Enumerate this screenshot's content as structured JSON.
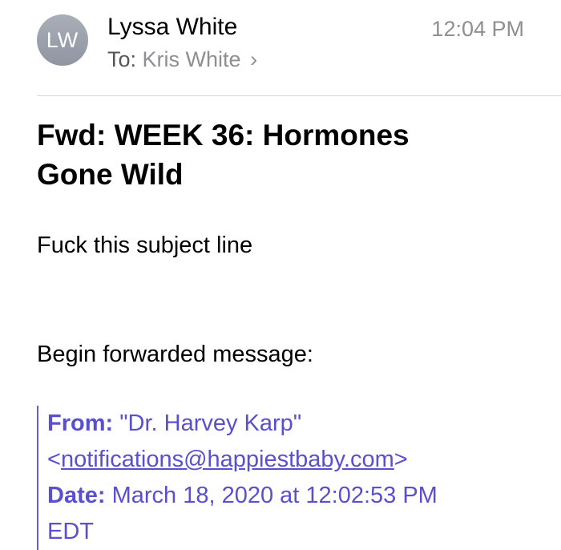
{
  "header": {
    "avatar_initials": "LW",
    "sender_name": "Lyssa White",
    "time": "12:04 PM",
    "to_label": "To:",
    "to_name": "Kris White",
    "to_chevron": "›"
  },
  "email": {
    "subject_line1": "Fwd:  WEEK 36: Hormones",
    "subject_line2": "Gone Wild",
    "body_text": "Fuck this subject line",
    "forward_intro": "Begin forwarded message:"
  },
  "forwarded": {
    "from_label": "From:",
    "from_name": "\"Dr. Harvey Karp\"",
    "from_email_open": "<",
    "from_email": "notifications@happiestbaby.com",
    "from_email_close": ">",
    "date_label": "Date:",
    "date_value": "March 18, 2020 at 12:02:53 PM",
    "date_tz": "EDT"
  },
  "colors": {
    "link_purple": "#5a4fcf",
    "meta_gray": "#8e8e93",
    "avatar_gray": "#9a9fab"
  }
}
